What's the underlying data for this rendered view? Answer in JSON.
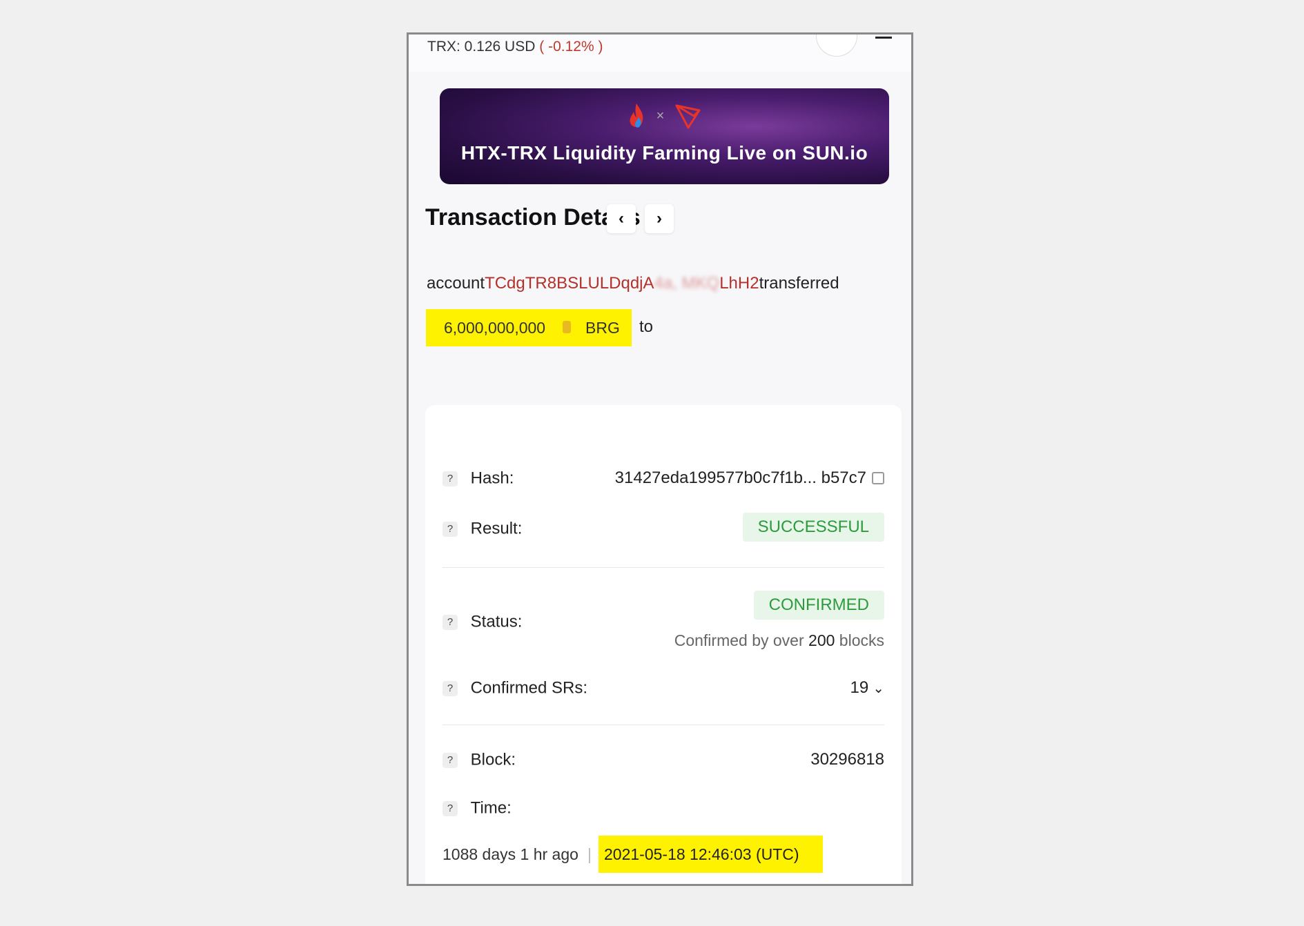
{
  "header": {
    "price_label": "TRX: 0.126 USD",
    "price_change": "( -0.12% )"
  },
  "banner": {
    "title": "HTX-TRX Liquidity Farming Live on SUN.io",
    "separator": "×"
  },
  "page": {
    "title": "Transaction Details",
    "prev_label": "‹",
    "next_label": "›"
  },
  "summary": {
    "prefix": "account",
    "from_address_visible_start": "TCdgTR8BSLULDqdjA",
    "from_address_blurred": "4a,  MKQ",
    "from_address_visible_end": "LhH2",
    "verb": "transferred",
    "amount": "6,000,000,000",
    "token": "BRG",
    "to": "to"
  },
  "details": {
    "hash_label": "Hash:",
    "hash_value": "31427eda199577b0c7f1b... b57c7",
    "result_label": "Result:",
    "result_value": "SUCCESSFUL",
    "status_label": "Status:",
    "status_value": "CONFIRMED",
    "confirmed_prefix": "Confirmed by over",
    "confirmed_blocks": "200",
    "confirmed_suffix": "blocks",
    "srs_label": "Confirmed SRs:",
    "srs_value": "19",
    "block_label": "Block:",
    "block_value": "30296818",
    "time_label": "Time:",
    "time_relative": "1088 days 1 hr ago",
    "time_separator": "|",
    "time_absolute": "2021-05-18 12:46:03 (UTC)",
    "help_glyph": "?"
  },
  "colors": {
    "highlight": "#fff200",
    "success_text": "#2e9a3e",
    "success_bg": "#e8f6e9",
    "address": "#b3312a"
  }
}
